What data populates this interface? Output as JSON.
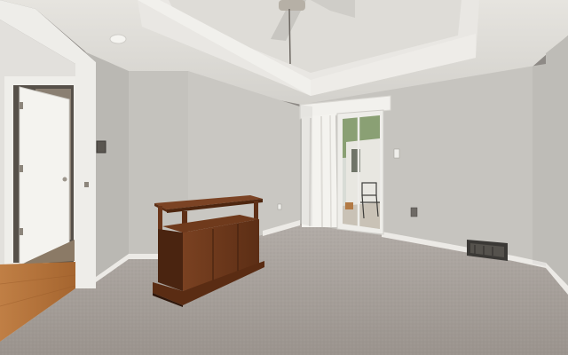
{
  "photo": {
    "subject": "room",
    "colors": {
      "wall": "#c9c7c2",
      "wall_shadow": "#b3b1ad",
      "ceiling": "#dcdad5",
      "carpet": "#a39d98",
      "wood_floor": "#b4753f",
      "trim": "#efeeea",
      "furniture_wood": "#6e3a1d"
    }
  }
}
